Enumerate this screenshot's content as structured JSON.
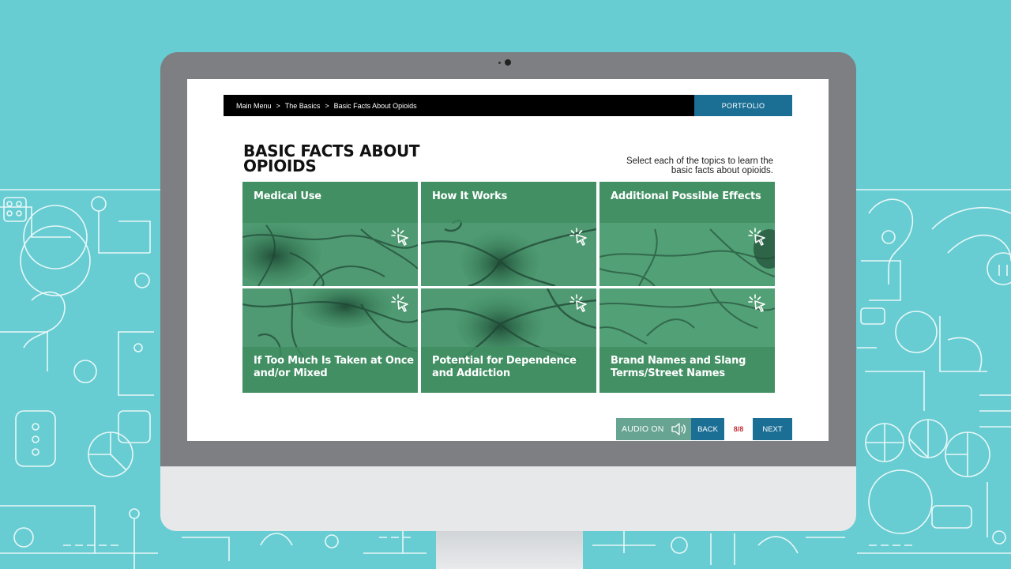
{
  "breadcrumb": {
    "items": [
      "Main Menu",
      "The Basics",
      "Basic Facts About Opioids"
    ],
    "separator": ">"
  },
  "header": {
    "portfolio_label": "PORTFOLIO"
  },
  "page": {
    "title_line1": "BASIC FACTS ABOUT",
    "title_line2": "OPIOIDS",
    "instructions_line1": "Select each of the topics to learn the",
    "instructions_line2": "basic facts about opioids."
  },
  "topics": [
    {
      "line1": "Medical Use",
      "line2": ""
    },
    {
      "line1": "How It Works",
      "line2": ""
    },
    {
      "line1": "Additional Possible Effects",
      "line2": ""
    },
    {
      "line1": "If Too Much Is Taken at Once",
      "line2": "and/or Mixed"
    },
    {
      "line1": "Potential for Dependence",
      "line2": "and Addiction"
    },
    {
      "line1": "Brand Names and Slang",
      "line2": "Terms/Street Names"
    }
  ],
  "footer": {
    "audio_label": "AUDIO ON",
    "back_label": "BACK",
    "page_counter": "8/8",
    "next_label": "NEXT"
  },
  "icons": {
    "topic": "click-cursor-icon",
    "audio": "speaker-icon"
  },
  "colors": {
    "background": "#67cdd2",
    "accent_blue": "#1b6f95",
    "tile_green": "#3e8a62",
    "audio_green": "#67a491",
    "counter_red": "#c0333a"
  }
}
